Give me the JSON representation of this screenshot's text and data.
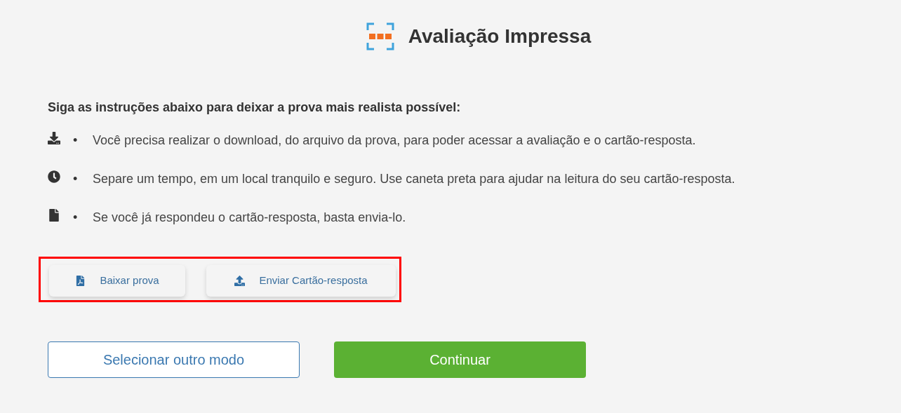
{
  "header": {
    "title": "Avaliação Impressa"
  },
  "instructions": {
    "heading": "Siga as instruções abaixo para deixar a prova mais realista possível:",
    "items": [
      {
        "kind": "download",
        "bullet": "•",
        "text": "Você precisa realizar o download, do arquivo da prova, para poder acessar a avaliação e o cartão-resposta."
      },
      {
        "kind": "clock",
        "bullet": "•",
        "text": "Separe um tempo, em um local tranquilo e seguro. Use caneta preta para ajudar na leitura do seu cartão-resposta."
      },
      {
        "kind": "file",
        "bullet": "•",
        "text": "Se você já respondeu o cartão-resposta, basta envia-lo."
      }
    ]
  },
  "actions": {
    "highlighted": true,
    "buttons": [
      {
        "kind": "pdf",
        "label": "Baixar prova"
      },
      {
        "kind": "upload",
        "label": "Enviar Cartão-resposta"
      }
    ]
  },
  "footer": {
    "buttons": [
      {
        "kind": "secondary",
        "label": "Selecionar outro modo"
      },
      {
        "kind": "primary",
        "label": "Continuar"
      }
    ]
  }
}
